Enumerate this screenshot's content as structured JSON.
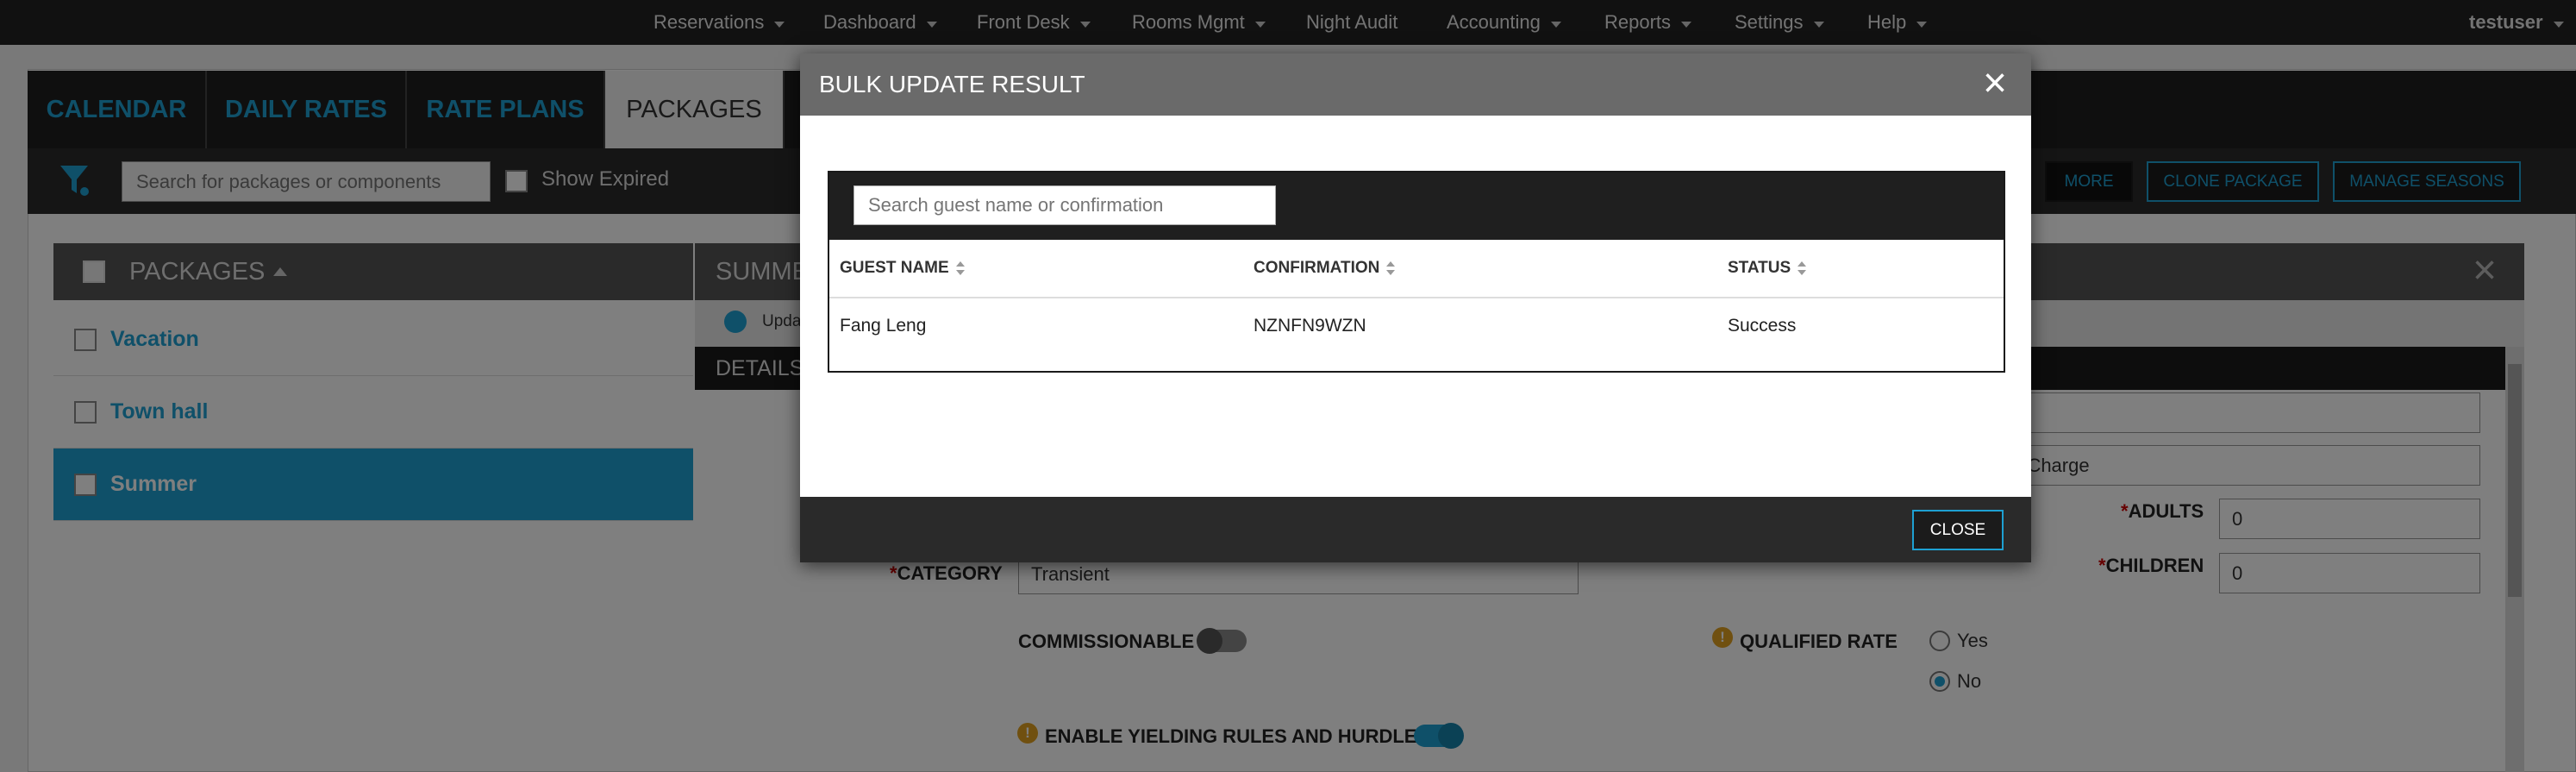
{
  "nav": {
    "items": [
      {
        "label": "Reservations",
        "caret": true
      },
      {
        "label": "Dashboard",
        "caret": true
      },
      {
        "label": "Front Desk",
        "caret": true
      },
      {
        "label": "Rooms Mgmt",
        "caret": true
      },
      {
        "label": "Night Audit",
        "caret": false
      },
      {
        "label": "Accounting",
        "caret": true
      },
      {
        "label": "Reports",
        "caret": true
      },
      {
        "label": "Settings",
        "caret": true
      },
      {
        "label": "Help",
        "caret": true
      }
    ],
    "user": "testuser"
  },
  "tabs": [
    {
      "label": "CALENDAR"
    },
    {
      "label": "DAILY RATES"
    },
    {
      "label": "RATE PLANS"
    },
    {
      "label": "PACKAGES",
      "active": true
    }
  ],
  "toolbar": {
    "search_placeholder": "Search for packages or components",
    "show_expired": "Show Expired",
    "more": "MORE",
    "clone_package": "CLONE PACKAGE",
    "manage_seasons": "MANAGE SEASONS"
  },
  "packages": {
    "header": "PACKAGES",
    "items": [
      {
        "label": "Vacation"
      },
      {
        "label": "Town hall"
      },
      {
        "label": "Summer",
        "selected": true
      }
    ]
  },
  "summary": {
    "header_partial": "SUMME",
    "update_partial": "Upda",
    "details_partial": "DETAILS"
  },
  "form": {
    "charge_partial": "m Charge",
    "adults_label": "ADULTS",
    "adults_value": "0",
    "children_label": "CHILDREN",
    "children_value": "0",
    "category_label": "CATEGORY",
    "category_value": "Transient",
    "commissionable_label": "COMMISSIONABLE",
    "qualified_rate_label": "QUALIFIED RATE",
    "yes_label": "Yes",
    "no_label": "No",
    "yielding_label": "ENABLE YIELDING RULES AND HURDLES",
    "required_mark": "*",
    "info_mark": "!"
  },
  "modal": {
    "title": "BULK UPDATE RESULT",
    "search_placeholder": "Search guest name or confirmation",
    "columns": [
      "GUEST NAME",
      "CONFIRMATION",
      "STATUS"
    ],
    "rows": [
      [
        "Fang Leng",
        "NZNFN9WZN",
        "Success"
      ]
    ],
    "close_label": "CLOSE"
  },
  "icons": {
    "close": "×"
  },
  "colors": {
    "accent": "#1ea0d2",
    "nav_bg": "#222222",
    "info": "#e0a020"
  }
}
